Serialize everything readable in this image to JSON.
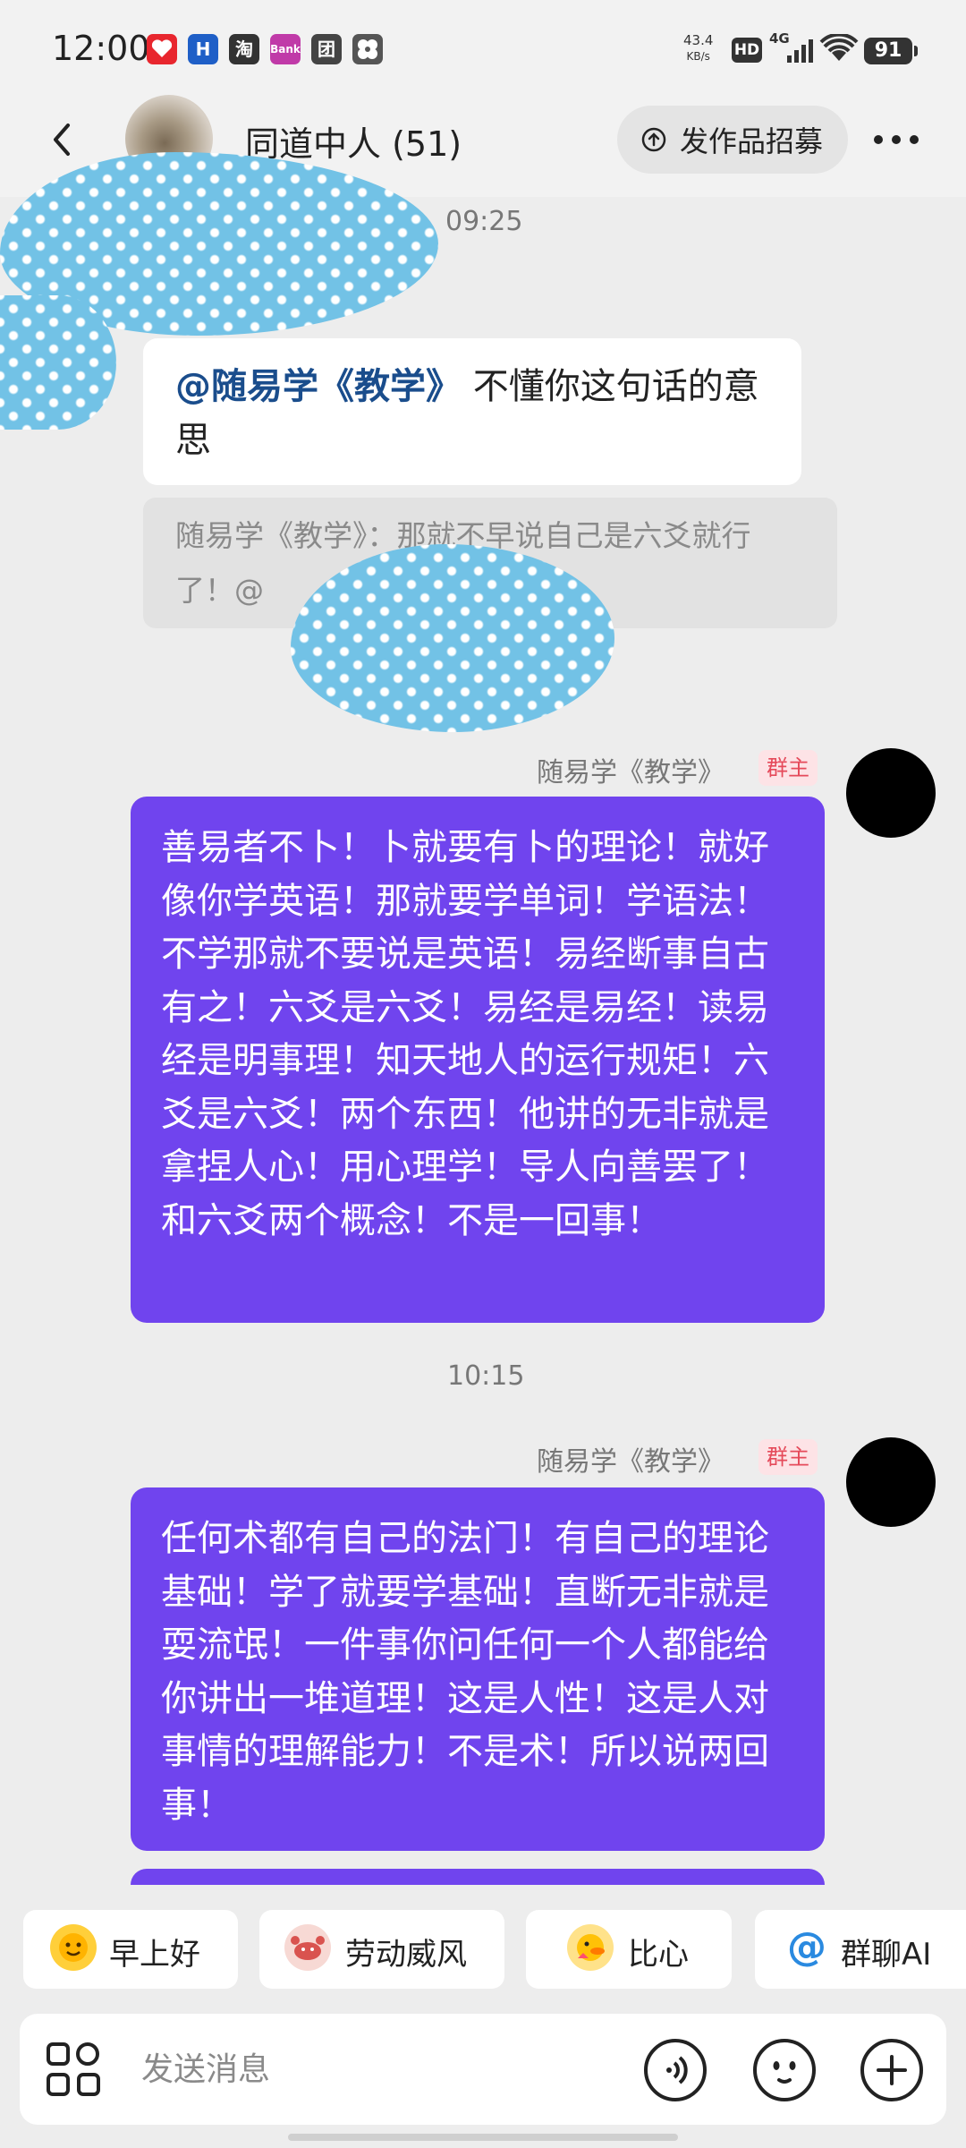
{
  "status_bar": {
    "time": "12:00",
    "app_icons": [
      {
        "name": "app-red-icon",
        "label": "",
        "color": "#e8262e"
      },
      {
        "name": "app-h-icon",
        "label": "H",
        "color": "#1f5fc7"
      },
      {
        "name": "taobao-icon",
        "label": "淘",
        "color": "#333333"
      },
      {
        "name": "bank-icon",
        "label": "Bank",
        "color": "#c03aa8"
      },
      {
        "name": "tuan-icon",
        "label": "团",
        "color": "#444444"
      },
      {
        "name": "pinwheel-icon",
        "label": "",
        "color": "#555555"
      }
    ],
    "net_speed_value": "43.4",
    "net_speed_unit": "KB/s",
    "hd": "HD",
    "network": "4G",
    "battery": "91"
  },
  "header": {
    "title": "同道中人 (51)",
    "recruit_button": "发作品招募"
  },
  "messages": {
    "timestamp_1": "09:25",
    "reply_mention": "@随易学《教学》",
    "reply_text": " 不懂你这句话的意思",
    "quote_text": "随易学《教学》：那就不早说自己是六爻就行了！@",
    "sender_1": "随易学《教学》",
    "badge_1": "群主",
    "message_1": "善易者不卜！卜就要有卜的理论！就好像你学英语！那就要学单词！学语法！不学那就不要说是英语！易经断事自古有之！六爻是六爻！易经是易经！读易经是明事理！知天地人的运行规矩！六爻是六爻！两个东西！他讲的无非就是拿捏人心！用心理学！导人向善罢了！和六爻两个概念！不是一回事！",
    "timestamp_2": "10:15",
    "sender_2": "随易学《教学》",
    "badge_2": "群主",
    "message_2": "任何术都有自己的法门！有自己的理论基础！学了就要学基础！直断无非就是耍流氓！一件事你问任何一个人都能给你讲出一堆道理！这是人性！这是人对事情的理解能力！不是术！所以说两回事！"
  },
  "quick_replies": [
    {
      "icon": "sun-face-icon",
      "label": "早上好"
    },
    {
      "icon": "crab-icon",
      "label": "劳动威风"
    },
    {
      "icon": "duck-icon",
      "label": "比心"
    },
    {
      "icon": "at-icon",
      "label": "群聊AI"
    }
  ],
  "input": {
    "placeholder": "发送消息"
  },
  "colors": {
    "accent_purple": "#7044ee",
    "mention_blue": "#1a4d8c",
    "badge_red": "#e54a5a",
    "mosaic_blue": "#72c2e6"
  }
}
